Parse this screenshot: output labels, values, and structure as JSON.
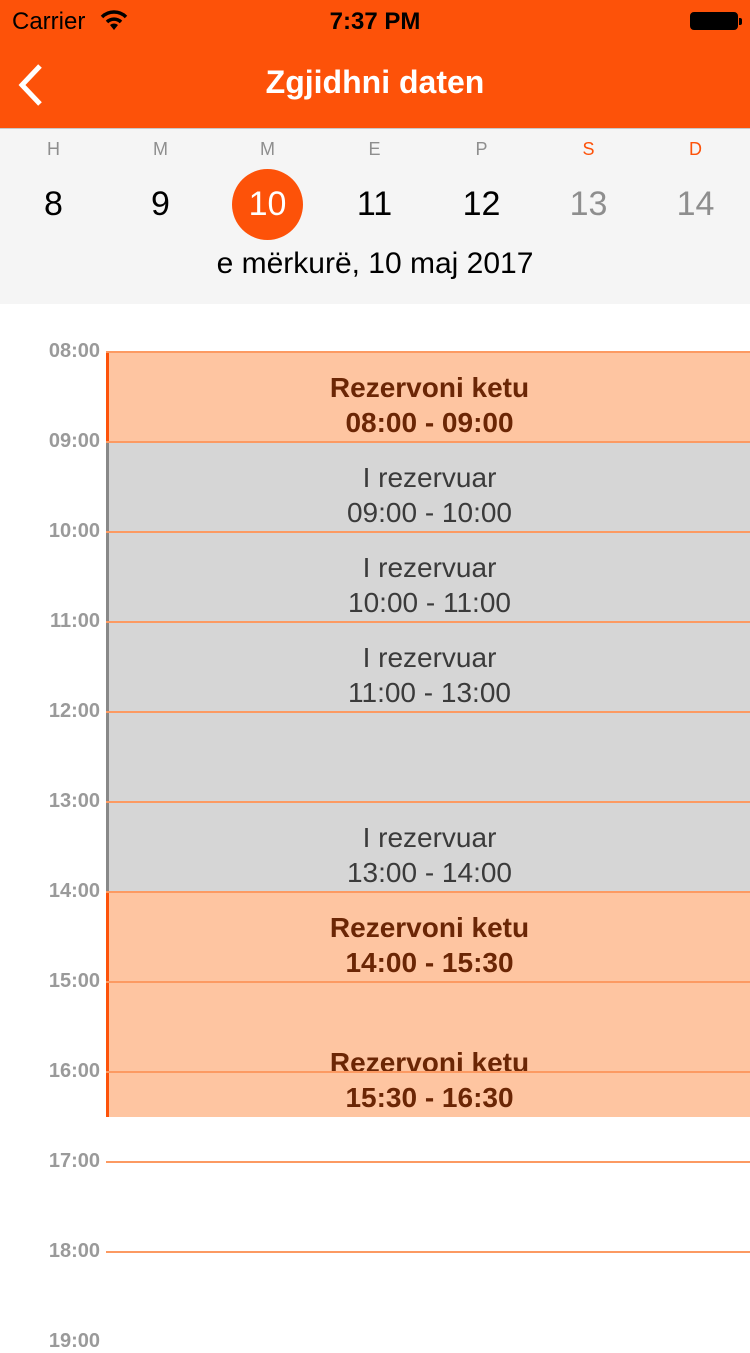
{
  "status": {
    "carrier": "Carrier",
    "time": "7:37 PM"
  },
  "nav": {
    "title": "Zgjidhni daten",
    "back_icon": "chevron-left-icon"
  },
  "week": {
    "days": [
      {
        "letter": "H",
        "num": "8"
      },
      {
        "letter": "M",
        "num": "9"
      },
      {
        "letter": "M",
        "num": "10",
        "selected": true
      },
      {
        "letter": "E",
        "num": "11"
      },
      {
        "letter": "P",
        "num": "12"
      },
      {
        "letter": "S",
        "num": "13",
        "weekend": true
      },
      {
        "letter": "D",
        "num": "14",
        "weekend": true
      }
    ],
    "selected_date": "e mërkurë, 10 maj 2017"
  },
  "hours": [
    "08:00",
    "09:00",
    "10:00",
    "11:00",
    "12:00",
    "13:00",
    "14:00",
    "15:00",
    "16:00",
    "17:00",
    "18:00",
    "19:00"
  ],
  "events": [
    {
      "title": "Rezervoni ketu",
      "time": "08:00 - 09:00",
      "type": "free",
      "start": 8,
      "end": 9
    },
    {
      "title": "I rezervuar",
      "time": "09:00 - 10:00",
      "type": "busy",
      "start": 9,
      "end": 10
    },
    {
      "title": "I rezervuar",
      "time": "10:00 - 11:00",
      "type": "busy",
      "start": 10,
      "end": 11
    },
    {
      "title": "I rezervuar",
      "time": "11:00 - 13:00",
      "type": "busy",
      "start": 11,
      "end": 13
    },
    {
      "title": "I rezervuar",
      "time": "13:00 - 14:00",
      "type": "busy",
      "start": 13,
      "end": 14
    },
    {
      "title": "Rezervoni ketu",
      "time": "14:00 - 15:30",
      "type": "free",
      "start": 14,
      "end": 15.5
    },
    {
      "title": "Rezervoni ketu",
      "time": "15:30 - 16:30",
      "type": "free",
      "start": 15.5,
      "end": 16.5
    }
  ],
  "colors": {
    "accent": "#fd5209",
    "free": "#fec5a1",
    "busy": "#d6d6d6"
  }
}
